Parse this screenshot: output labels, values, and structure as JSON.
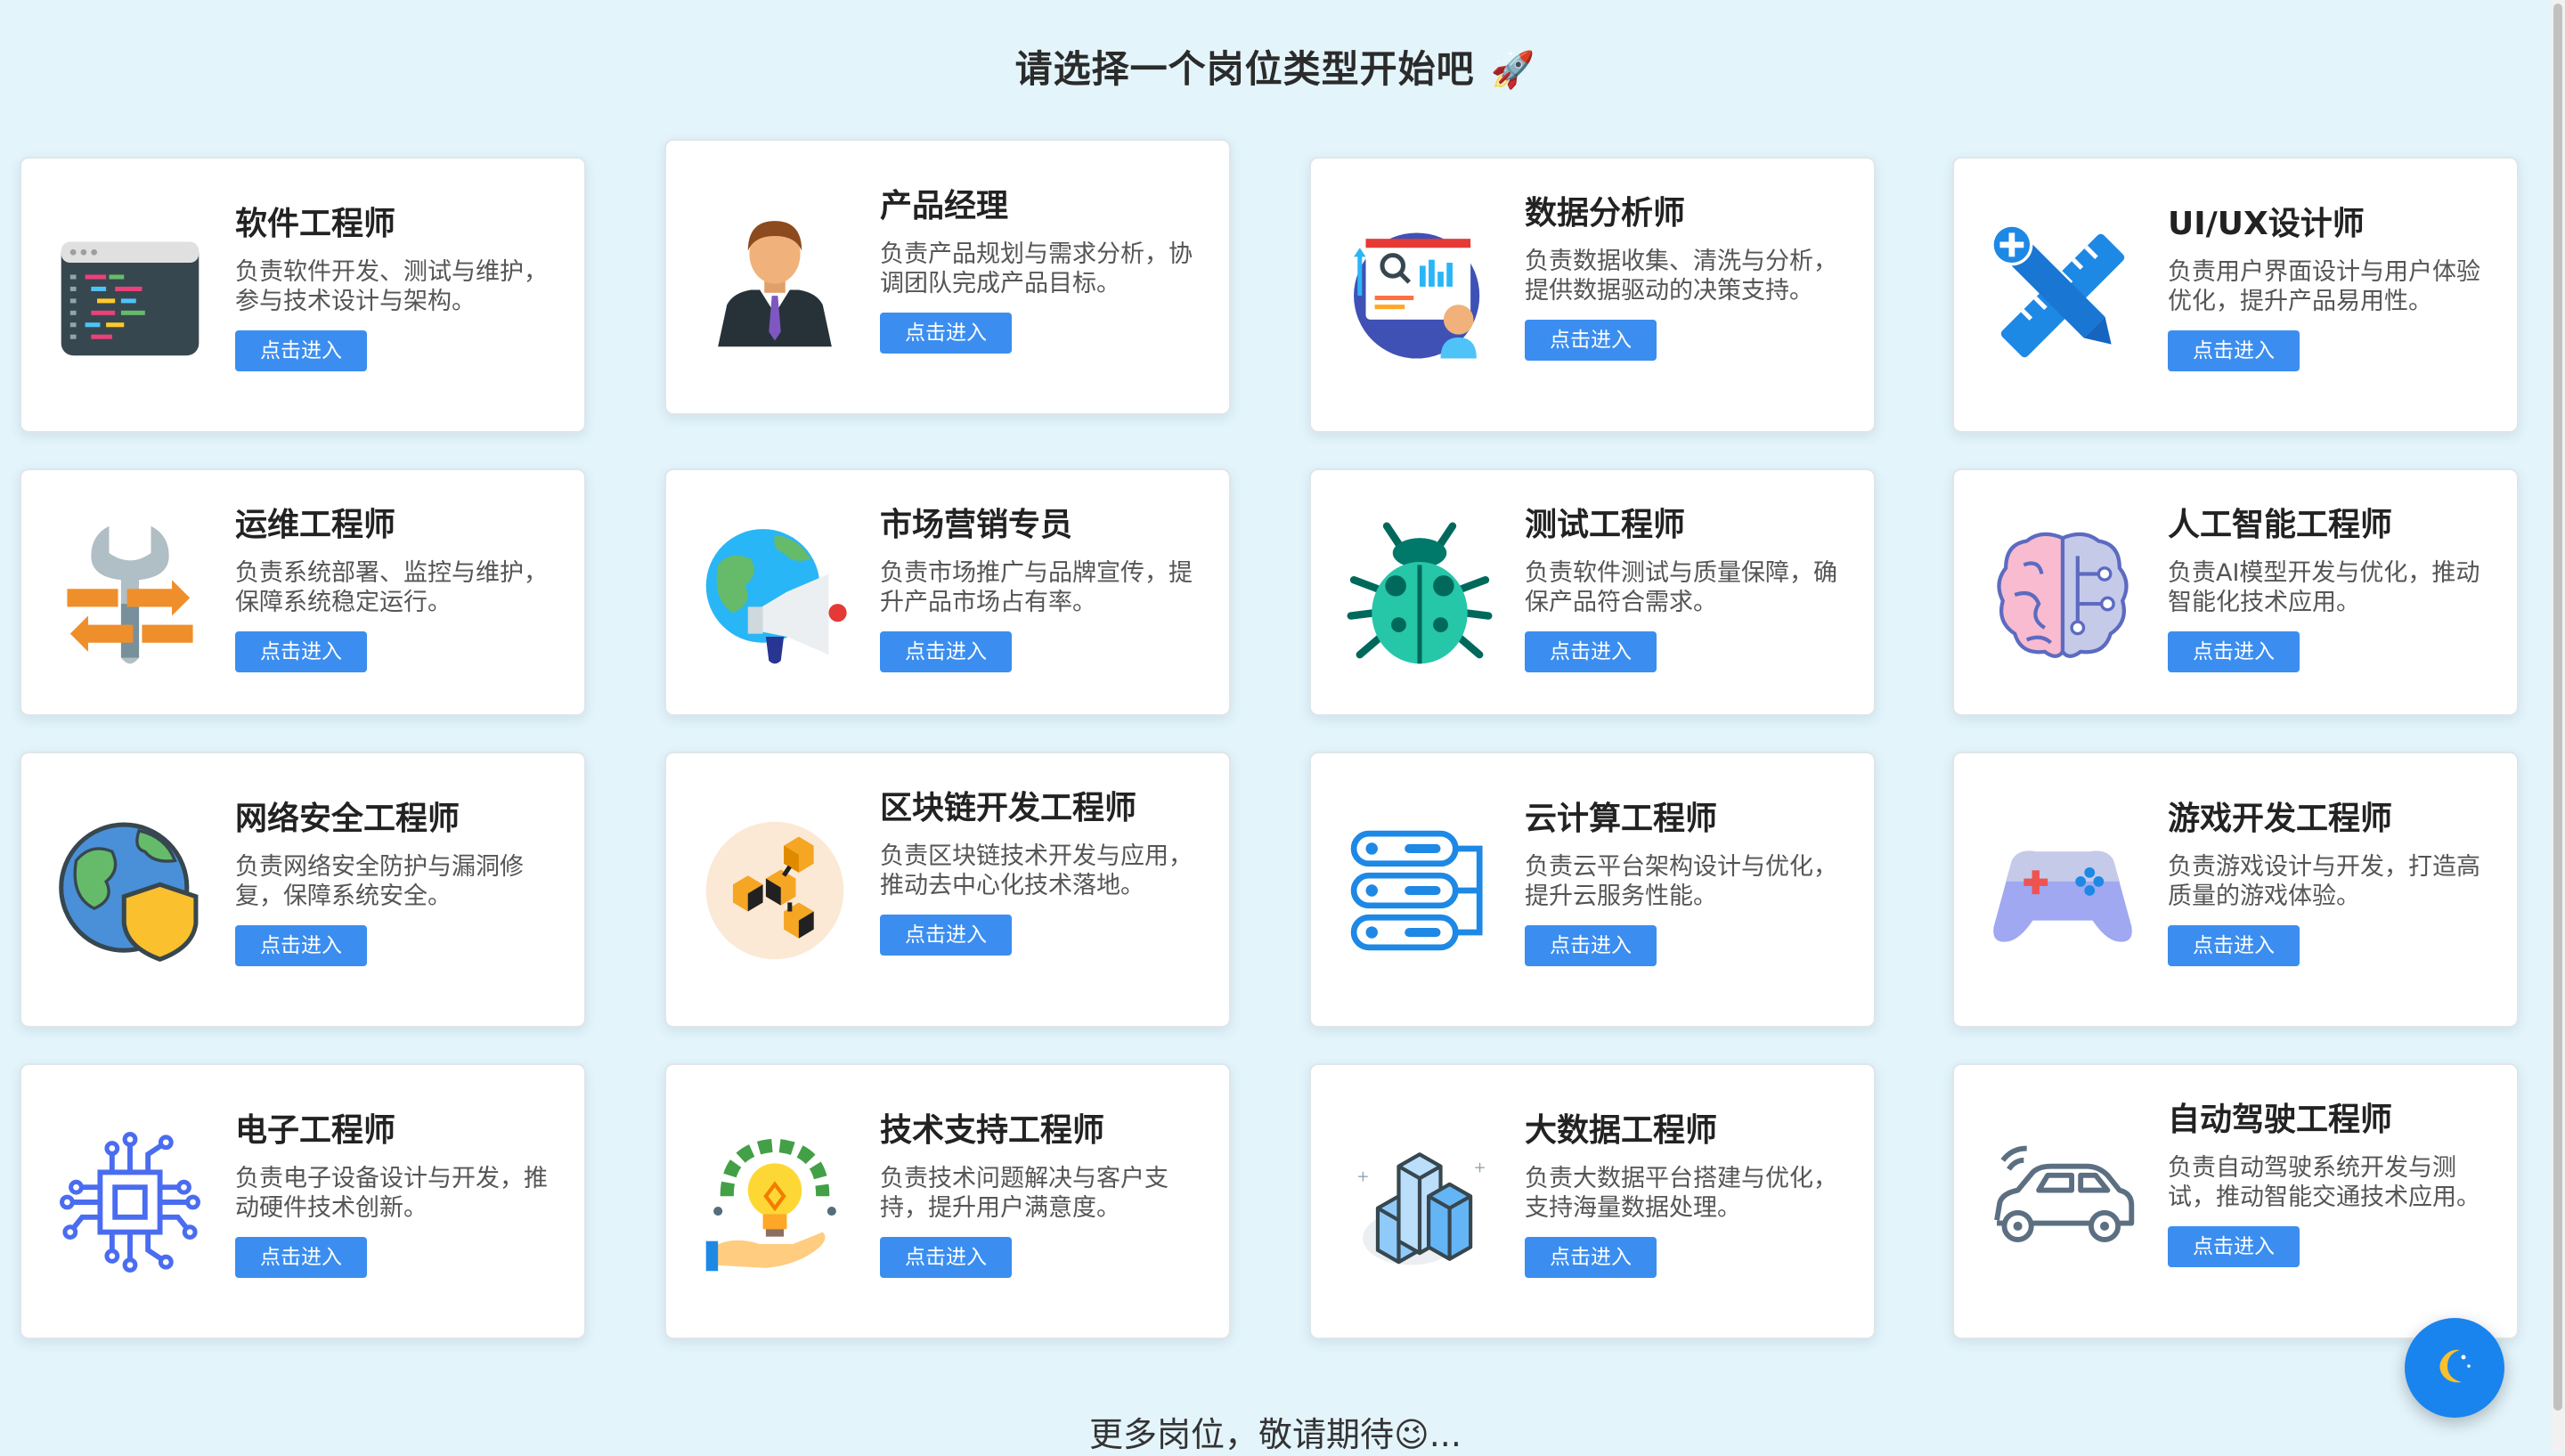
{
  "header": {
    "title": "请选择一个岗位类型开始吧",
    "title_emoji": "🚀"
  },
  "button_label": "点击进入",
  "cards": [
    {
      "title": "软件工程师",
      "desc": "负责软件开发、测试与维护，参与技术设计与架构。",
      "icon": "code-window-icon"
    },
    {
      "title": "产品经理",
      "desc": "负责产品规划与需求分析，协调团队完成产品目标。",
      "icon": "businessman-icon"
    },
    {
      "title": "数据分析师",
      "desc": "负责数据收集、清洗与分析，提供数据驱动的决策支持。",
      "icon": "data-analysis-icon"
    },
    {
      "title": "UI/UX设计师",
      "desc": "负责用户界面设计与用户体验优化，提升产品易用性。",
      "icon": "pencil-ruler-icon"
    },
    {
      "title": "运维工程师",
      "desc": "负责系统部署、监控与维护，保障系统稳定运行。",
      "icon": "wrench-arrows-icon"
    },
    {
      "title": "市场营销专员",
      "desc": "负责市场推广与品牌宣传，提升产品市场占有率。",
      "icon": "globe-megaphone-icon"
    },
    {
      "title": "测试工程师",
      "desc": "负责软件测试与质量保障，确保产品符合需求。",
      "icon": "bug-icon"
    },
    {
      "title": "人工智能工程师",
      "desc": "负责AI模型开发与优化，推动智能化技术应用。",
      "icon": "ai-brain-icon"
    },
    {
      "title": "网络安全工程师",
      "desc": "负责网络安全防护与漏洞修复，保障系统安全。",
      "icon": "globe-shield-icon"
    },
    {
      "title": "区块链开发工程师",
      "desc": "负责区块链技术开发与应用，推动去中心化技术落地。",
      "icon": "blockchain-icon"
    },
    {
      "title": "云计算工程师",
      "desc": "负责云平台架构设计与优化，提升云服务性能。",
      "icon": "server-stack-icon"
    },
    {
      "title": "游戏开发工程师",
      "desc": "负责游戏设计与开发，打造高质量的游戏体验。",
      "icon": "gamepad-icon"
    },
    {
      "title": "电子工程师",
      "desc": "负责电子设备设计与开发，推动硬件技术创新。",
      "icon": "circuit-chip-icon"
    },
    {
      "title": "技术支持工程师",
      "desc": "负责技术问题解决与客户支持，提升用户满意度。",
      "icon": "lightbulb-gear-icon"
    },
    {
      "title": "大数据工程师",
      "desc": "负责大数据平台搭建与优化，支持海量数据处理。",
      "icon": "big-data-cubes-icon"
    },
    {
      "title": "自动驾驶工程师",
      "desc": "负责自动驾驶系统开发与测试，推动智能交通技术应用。",
      "icon": "autonomous-car-icon"
    }
  ],
  "footer": {
    "text": "更多岗位，敬请期待",
    "emoji": "😉",
    "ellipsis": "..."
  },
  "theme_toggle": {
    "icon": "moon-icon",
    "color": "#1a84ee"
  },
  "colors": {
    "background": "#e3f4fb",
    "button": "#3b8ef0"
  }
}
